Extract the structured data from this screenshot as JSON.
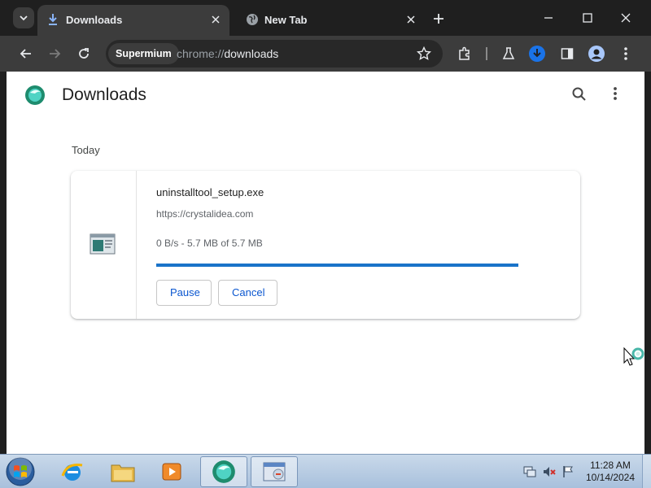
{
  "browser": {
    "tabs": [
      {
        "title": "Downloads",
        "icon": "download-icon",
        "active": true
      },
      {
        "title": "New Tab",
        "icon": "globe-icon",
        "active": false
      }
    ],
    "omnibox": {
      "chip": "Supermium",
      "scheme": "chrome://",
      "host": "downloads"
    }
  },
  "page": {
    "title": "Downloads",
    "section_label": "Today"
  },
  "download": {
    "file_name": "uninstalltool_setup.exe",
    "url": "https://crystalidea.com",
    "status": "0 B/s - 5.7 MB of 5.7 MB",
    "progress": 1.0,
    "pause_label": "Pause",
    "cancel_label": "Cancel"
  },
  "taskbar": {
    "time": "11:28 AM",
    "date": "10/14/2024"
  },
  "colors": {
    "accent": "#0b57d0",
    "progress": "#1a73c9",
    "frame": "#1f1f1f",
    "toolbar": "#3c3c3c"
  }
}
